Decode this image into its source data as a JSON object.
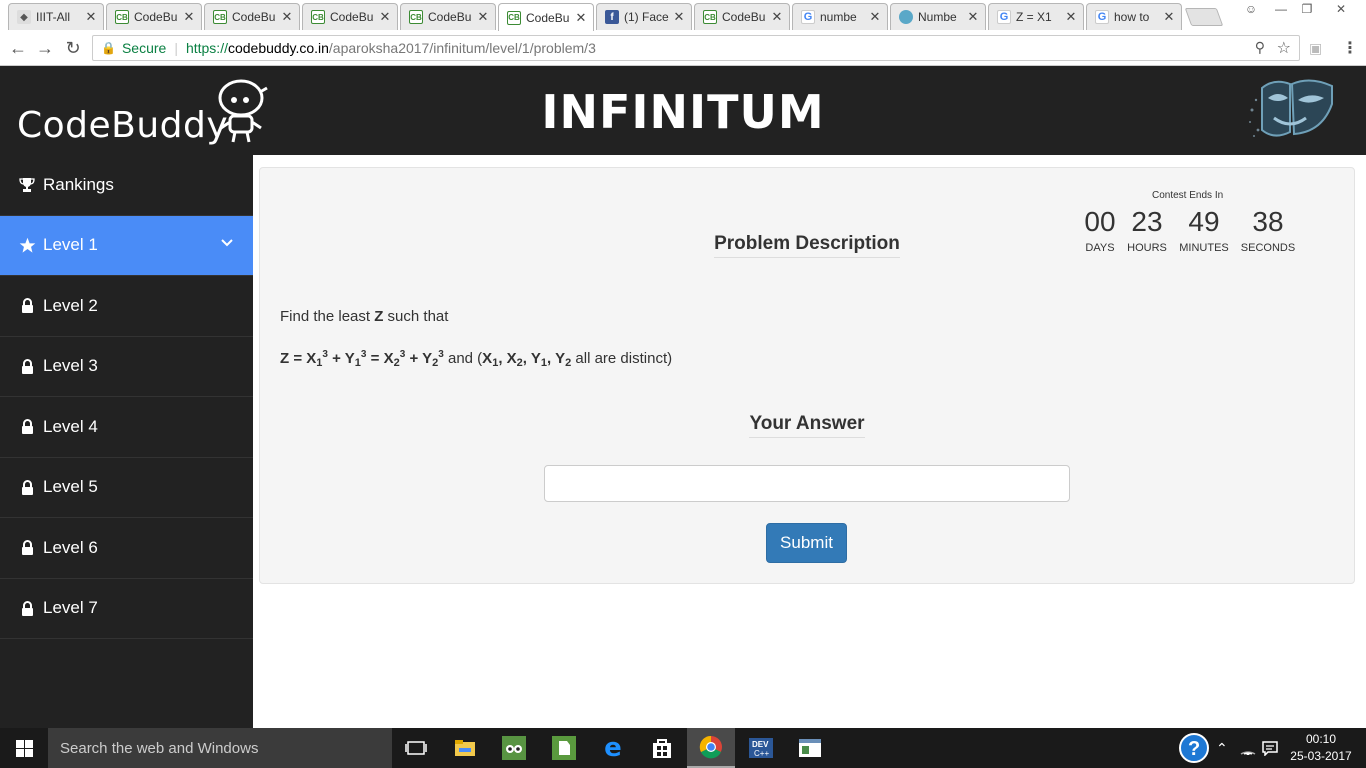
{
  "browser": {
    "tabs": [
      {
        "title": "IIIT-All",
        "favicon": "iiit-icon",
        "active": false
      },
      {
        "title": "CodeBu",
        "favicon": "codebuddy-icon",
        "active": false
      },
      {
        "title": "CodeBu",
        "favicon": "codebuddy-icon",
        "active": false
      },
      {
        "title": "CodeBu",
        "favicon": "codebuddy-icon",
        "active": false
      },
      {
        "title": "CodeBu",
        "favicon": "codebuddy-icon",
        "active": false
      },
      {
        "title": "CodeBu",
        "favicon": "codebuddy-icon",
        "active": true
      },
      {
        "title": "(1) Face",
        "favicon": "facebook-icon",
        "active": false
      },
      {
        "title": "CodeBu",
        "favicon": "codebuddy-icon",
        "active": false
      },
      {
        "title": "numbe",
        "favicon": "google-icon",
        "active": false
      },
      {
        "title": "Numbe",
        "favicon": "number-icon",
        "active": false
      },
      {
        "title": "Z = X1",
        "favicon": "google-icon",
        "active": false
      },
      {
        "title": "how to",
        "favicon": "google-icon",
        "active": false
      }
    ],
    "address": {
      "secure_label": "Secure",
      "protocol": "https://",
      "host": "codebuddy.co.in",
      "path": "/aparoksha2017/infinitum/level/1/problem/3"
    }
  },
  "site": {
    "brand": "CodeBuddy",
    "event_title": "INFINITUM"
  },
  "sidebar": {
    "items": [
      {
        "label": "Rankings",
        "icon": "trophy-icon",
        "active": false
      },
      {
        "label": "Level 1",
        "icon": "star-icon",
        "active": true
      },
      {
        "label": "Level 2",
        "icon": "lock-icon",
        "active": false
      },
      {
        "label": "Level 3",
        "icon": "lock-icon",
        "active": false
      },
      {
        "label": "Level 4",
        "icon": "lock-icon",
        "active": false
      },
      {
        "label": "Level 5",
        "icon": "lock-icon",
        "active": false
      },
      {
        "label": "Level 6",
        "icon": "lock-icon",
        "active": false
      },
      {
        "label": "Level 7",
        "icon": "lock-icon",
        "active": false
      }
    ]
  },
  "countdown": {
    "title": "Contest Ends In",
    "units": [
      {
        "value": "00",
        "label": "DAYS"
      },
      {
        "value": "23",
        "label": "HOURS"
      },
      {
        "value": "49",
        "label": "MINUTES"
      },
      {
        "value": "38",
        "label": "SECONDS"
      }
    ]
  },
  "problem": {
    "heading": "Problem Description",
    "line1_prefix": "Find the least ",
    "line1_var": "Z",
    "line1_suffix": " such that",
    "eq": {
      "z": "Z = X",
      "sub1": "1",
      "sup3": "3",
      "plus_y": " + Y",
      "eq_x": " = X",
      "sub2": "2",
      "and_text": " and (",
      "x": "X",
      "y": "Y",
      "comma": ", ",
      "distinct": " all are distinct)"
    }
  },
  "answer": {
    "heading": "Your Answer",
    "value": "",
    "submit_label": "Submit"
  },
  "taskbar": {
    "search_placeholder": "Search the web and Windows",
    "time": "00:10",
    "date": "25-03-2017"
  }
}
